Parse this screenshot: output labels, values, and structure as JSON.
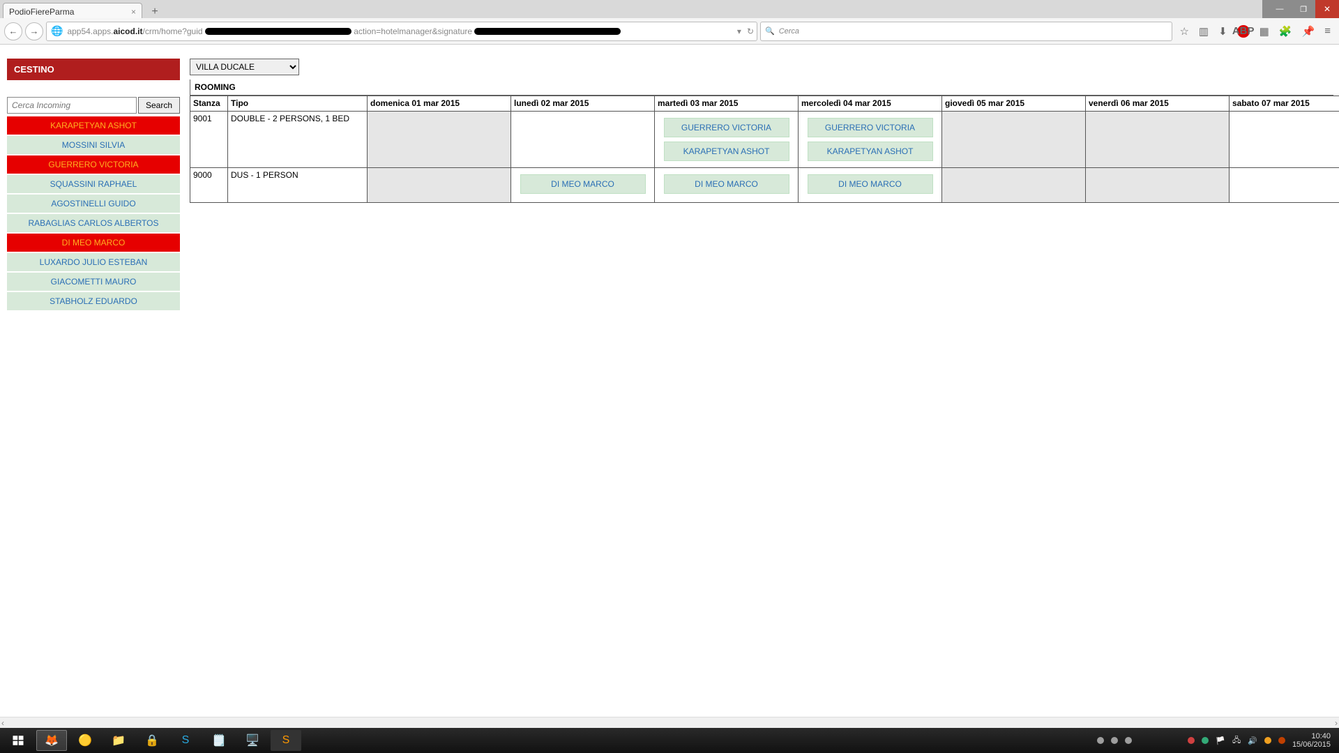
{
  "browser_tab": {
    "title": "PodioFiereParma"
  },
  "url": {
    "prefix": "app54.apps.",
    "domain": "aicod.it",
    "path1": "/crm/home?guid",
    "mid": "action=hotelmanager&signature",
    "reload": "↻"
  },
  "searchbox": {
    "placeholder": "Cerca"
  },
  "sidebar": {
    "title": "CESTINO",
    "search_placeholder": "Cerca Incoming",
    "search_button": "Search",
    "people": [
      {
        "name": "KARAPETYAN ASHOT",
        "hl": true
      },
      {
        "name": "MOSSINI SILVIA",
        "hl": false
      },
      {
        "name": "GUERRERO VICTORIA",
        "hl": true
      },
      {
        "name": "SQUASSINI RAPHAEL",
        "hl": false
      },
      {
        "name": "AGOSTINELLI GUIDO",
        "hl": false
      },
      {
        "name": "RABAGLIAS CARLOS ALBERTOS",
        "hl": false
      },
      {
        "name": "DI MEO MARCO",
        "hl": true
      },
      {
        "name": "LUXARDO JULIO ESTEBAN",
        "hl": false
      },
      {
        "name": "GIACOMETTI MAURO",
        "hl": false
      },
      {
        "name": "STABHOLZ EDUARDO",
        "hl": false
      }
    ]
  },
  "main": {
    "hotel_selected": "VILLA DUCALE",
    "section_label": "ROOMING",
    "headers": {
      "stanza": "Stanza",
      "tipo": "Tipo",
      "d0": "domenica 01 mar 2015",
      "d1": "lunedì 02 mar 2015",
      "d2": "martedì 03 mar 2015",
      "d3": "mercoledì 04 mar 2015",
      "d4": "giovedì 05 mar 2015",
      "d5": "venerdì 06 mar 2015",
      "d6": "sabato 07 mar 2015"
    },
    "rows": [
      {
        "stanza": "9001",
        "tipo": "DOUBLE - 2 PERSONS, 1 BED",
        "d2": [
          "GUERRERO VICTORIA",
          "KARAPETYAN ASHOT"
        ],
        "d3": [
          "GUERRERO VICTORIA",
          "KARAPETYAN ASHOT"
        ]
      },
      {
        "stanza": "9000",
        "tipo": "DUS - 1 PERSON",
        "d1": [
          "DI MEO MARCO"
        ],
        "d2": [
          "DI MEO MARCO"
        ],
        "d3": [
          "DI MEO MARCO"
        ]
      }
    ]
  },
  "tray": {
    "time": "10:40",
    "date": "15/06/2015"
  }
}
